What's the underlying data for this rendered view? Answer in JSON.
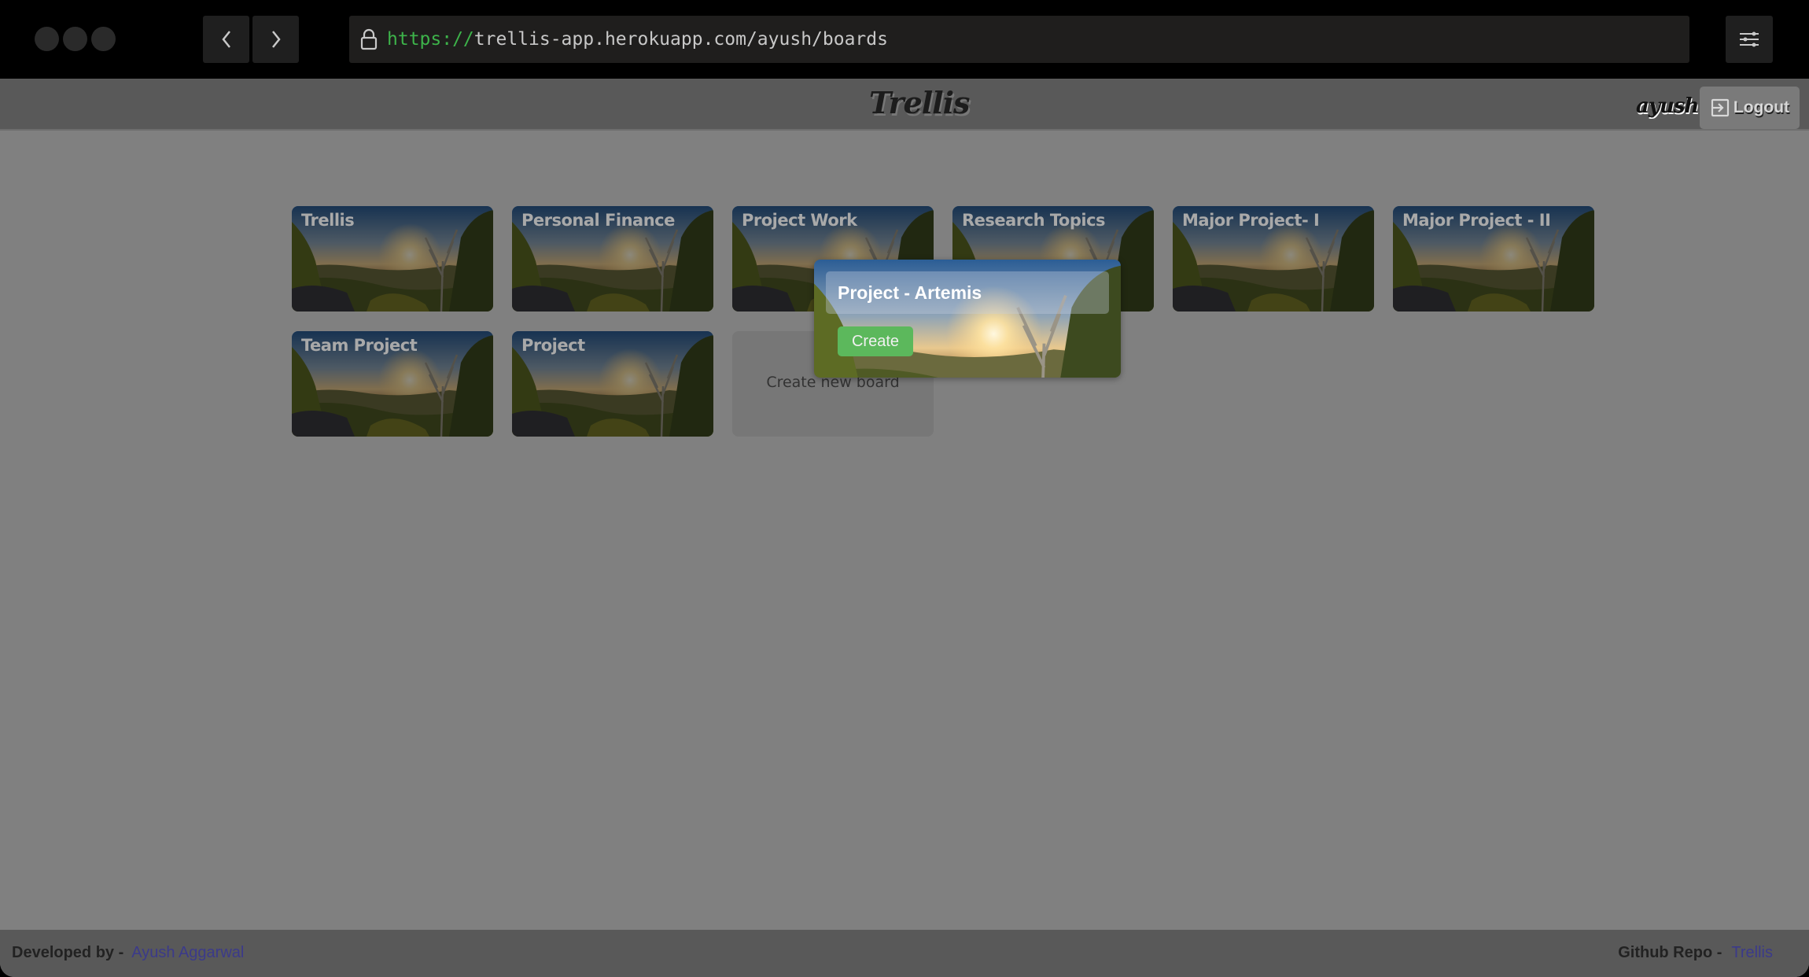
{
  "browser": {
    "url_scheme": "https://",
    "url_rest": "trellis-app.herokuapp.com/ayush/boards",
    "icons": {
      "back": "chevron-left-icon",
      "forward": "chevron-right-icon",
      "lock": "lock-icon",
      "settings": "sliders-icon"
    }
  },
  "header": {
    "logo": "Trellis",
    "username": "ayush",
    "logout_label": "Logout",
    "logout_icon": "sign-out-icon"
  },
  "boards": [
    {
      "title": "Trellis"
    },
    {
      "title": "Personal Finance"
    },
    {
      "title": "Project Work"
    },
    {
      "title": "Research Topics"
    },
    {
      "title": "Major Project- I"
    },
    {
      "title": "Major Project - II"
    },
    {
      "title": "Team Project"
    },
    {
      "title": "Project"
    }
  ],
  "create_tile": {
    "label": "Create new board"
  },
  "new_board_popup": {
    "input_value": "Project - Artemis",
    "create_label": "Create"
  },
  "footer": {
    "developed_label": "Developed by -",
    "developer_name": "Ayush Aggarwal",
    "repo_label": "Github Repo -",
    "repo_name": "Trellis"
  },
  "colors": {
    "create_button": "#5cb85c",
    "url_scheme": "#3db34a",
    "footer_link": "#3b3a8a"
  }
}
